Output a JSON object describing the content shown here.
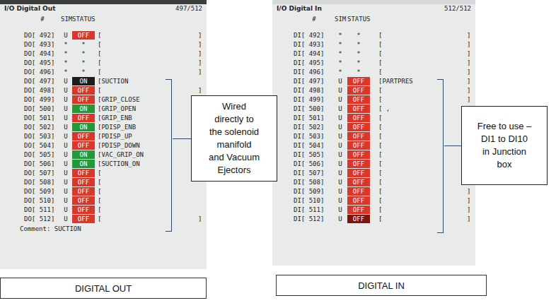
{
  "screens": [
    {
      "title": "I/O Digital Out",
      "page": "497/512",
      "columns": [
        "#",
        "SIM",
        "STATUS"
      ],
      "rows": [
        {
          "id": "DO[ 492]",
          "sim": "U",
          "kind": "signal",
          "status": "OFF",
          "on": false,
          "selected": false,
          "comment": "[",
          "end": "]"
        },
        {
          "id": "DO[ 493]",
          "sim": "*",
          "kind": "unassigned",
          "status": "*",
          "on": false,
          "selected": false,
          "comment": "[",
          "end": "]"
        },
        {
          "id": "DO[ 494]",
          "sim": "*",
          "kind": "unassigned",
          "status": "*",
          "on": false,
          "selected": false,
          "comment": "[",
          "end": "]"
        },
        {
          "id": "DO[ 495]",
          "sim": "*",
          "kind": "unassigned",
          "status": "*",
          "on": false,
          "selected": false,
          "comment": "[",
          "end": "]"
        },
        {
          "id": "DO[ 496]",
          "sim": "*",
          "kind": "unassigned",
          "status": "*",
          "on": false,
          "selected": false,
          "comment": "[",
          "end": "]"
        },
        {
          "id": "DO[ 497]",
          "sim": "U",
          "kind": "signal",
          "status": "ON",
          "on": true,
          "selected": true,
          "comment": "[SUCTION",
          "end": ""
        },
        {
          "id": "DO[ 498]",
          "sim": "U",
          "kind": "signal",
          "status": "OFF",
          "on": false,
          "selected": false,
          "comment": "[",
          "end": "]"
        },
        {
          "id": "DO[ 499]",
          "sim": "U",
          "kind": "signal",
          "status": "OFF",
          "on": false,
          "selected": false,
          "comment": "[GRIP_CLOSE",
          "end": ""
        },
        {
          "id": "DO[ 500]",
          "sim": "U",
          "kind": "signal",
          "status": "ON",
          "on": true,
          "selected": false,
          "comment": "[GRIP_OPEN",
          "end": ""
        },
        {
          "id": "DO[ 501]",
          "sim": "U",
          "kind": "signal",
          "status": "OFF",
          "on": false,
          "selected": false,
          "comment": "[GRIP_ENB",
          "end": ""
        },
        {
          "id": "DO[ 502]",
          "sim": "U",
          "kind": "signal",
          "status": "ON",
          "on": true,
          "selected": false,
          "comment": "[PDISP_ENB",
          "end": ""
        },
        {
          "id": "DO[ 503]",
          "sim": "U",
          "kind": "signal",
          "status": "OFF",
          "on": false,
          "selected": false,
          "comment": "[PDISP_UP",
          "end": ""
        },
        {
          "id": "DO[ 504]",
          "sim": "U",
          "kind": "signal",
          "status": "OFF",
          "on": false,
          "selected": false,
          "comment": "[PDISP_DOWN",
          "end": ""
        },
        {
          "id": "DO[ 505]",
          "sim": "U",
          "kind": "signal",
          "status": "ON",
          "on": true,
          "selected": false,
          "comment": "[VAC_GRIP_ON",
          "end": ""
        },
        {
          "id": "DO[ 506]",
          "sim": "U",
          "kind": "signal",
          "status": "ON",
          "on": true,
          "selected": false,
          "comment": "[SUCTION_ON",
          "end": ""
        },
        {
          "id": "DO[ 507]",
          "sim": "U",
          "kind": "signal",
          "status": "OFF",
          "on": false,
          "selected": false,
          "comment": "[",
          "end": ""
        },
        {
          "id": "DO[ 508]",
          "sim": "U",
          "kind": "signal",
          "status": "OFF",
          "on": false,
          "selected": false,
          "comment": "[",
          "end": ""
        },
        {
          "id": "DO[ 509]",
          "sim": "U",
          "kind": "signal",
          "status": "OFF",
          "on": false,
          "selected": false,
          "comment": "[",
          "end": ""
        },
        {
          "id": "DO[ 510]",
          "sim": "U",
          "kind": "signal",
          "status": "OFF",
          "on": false,
          "selected": false,
          "comment": "[",
          "end": ""
        },
        {
          "id": "DO[ 511]",
          "sim": "U",
          "kind": "signal",
          "status": "OFF",
          "on": false,
          "selected": false,
          "comment": "[",
          "end": ""
        },
        {
          "id": "DO[ 512]",
          "sim": "U",
          "kind": "signal",
          "status": "OFF",
          "on": false,
          "selected": false,
          "comment": "[",
          "end": "]"
        }
      ],
      "comment": "Comment: SUCTION"
    },
    {
      "title": "I/O Digital In",
      "page": "512/512",
      "columns": [
        "#",
        "SIM",
        "STATUS"
      ],
      "rows": [
        {
          "id": "DI[ 492]",
          "sim": "*",
          "kind": "unassigned",
          "status": "*",
          "on": false,
          "selected": false,
          "comment": "[",
          "end": "]"
        },
        {
          "id": "DI[ 493]",
          "sim": "*",
          "kind": "unassigned",
          "status": "*",
          "on": false,
          "selected": false,
          "comment": "[",
          "end": "]"
        },
        {
          "id": "DI[ 494]",
          "sim": "*",
          "kind": "unassigned",
          "status": "*",
          "on": false,
          "selected": false,
          "comment": "[",
          "end": "]"
        },
        {
          "id": "DI[ 495]",
          "sim": "*",
          "kind": "unassigned",
          "status": "*",
          "on": false,
          "selected": false,
          "comment": "[",
          "end": "]"
        },
        {
          "id": "DI[ 496]",
          "sim": "*",
          "kind": "unassigned",
          "status": "*",
          "on": false,
          "selected": false,
          "comment": "[",
          "end": "]"
        },
        {
          "id": "DI[ 497]",
          "sim": "U",
          "kind": "signal",
          "status": "OFF",
          "on": false,
          "selected": false,
          "comment": "[PARTPRES",
          "end": "]"
        },
        {
          "id": "DI[ 498]",
          "sim": "U",
          "kind": "signal",
          "status": "OFF",
          "on": false,
          "selected": false,
          "comment": "[",
          "end": "]"
        },
        {
          "id": "DI[ 499]",
          "sim": "U",
          "kind": "signal",
          "status": "OFF",
          "on": false,
          "selected": false,
          "comment": "[",
          "end": "]"
        },
        {
          "id": "DI[ 500]",
          "sim": "U",
          "kind": "signal",
          "status": "OFF",
          "on": false,
          "selected": false,
          "comment": "[ ,",
          "end": "]"
        },
        {
          "id": "DI[ 501]",
          "sim": "U",
          "kind": "signal",
          "status": "OFF",
          "on": false,
          "selected": false,
          "comment": "[",
          "end": "]"
        },
        {
          "id": "DI[ 502]",
          "sim": "U",
          "kind": "signal",
          "status": "OFF",
          "on": false,
          "selected": false,
          "comment": "[",
          "end": "]"
        },
        {
          "id": "DI[ 503]",
          "sim": "U",
          "kind": "signal",
          "status": "OFF",
          "on": false,
          "selected": false,
          "comment": "[",
          "end": "]"
        },
        {
          "id": "DI[ 504]",
          "sim": "U",
          "kind": "signal",
          "status": "OFF",
          "on": false,
          "selected": false,
          "comment": "[",
          "end": "]"
        },
        {
          "id": "DI[ 505]",
          "sim": "U",
          "kind": "signal",
          "status": "OFF",
          "on": false,
          "selected": false,
          "comment": "[",
          "end": "]"
        },
        {
          "id": "DI[ 506]",
          "sim": "U",
          "kind": "signal",
          "status": "OFF",
          "on": false,
          "selected": false,
          "comment": "[",
          "end": "]"
        },
        {
          "id": "DI[ 507]",
          "sim": "U",
          "kind": "signal",
          "status": "OFF",
          "on": false,
          "selected": false,
          "comment": "[",
          "end": "]"
        },
        {
          "id": "DI[ 508]",
          "sim": "U",
          "kind": "signal",
          "status": "OFF",
          "on": false,
          "selected": false,
          "comment": "[",
          "end": "]"
        },
        {
          "id": "DI[ 509]",
          "sim": "U",
          "kind": "signal",
          "status": "OFF",
          "on": false,
          "selected": false,
          "comment": "[",
          "end": "]"
        },
        {
          "id": "DI[ 510]",
          "sim": "U",
          "kind": "signal",
          "status": "OFF",
          "on": false,
          "selected": false,
          "comment": "[",
          "end": "]"
        },
        {
          "id": "DI[ 511]",
          "sim": "U",
          "kind": "signal",
          "status": "OFF",
          "on": false,
          "selected": false,
          "comment": "[",
          "end": "]"
        },
        {
          "id": "DI[ 512]",
          "sim": "U",
          "kind": "signal",
          "status": "OFF",
          "on": false,
          "selected": true,
          "comment": "[",
          "end": "]"
        }
      ],
      "comment": ""
    }
  ],
  "notes": [
    {
      "lines": [
        "Wired",
        "directly to",
        "the solenoid",
        "manifold",
        "and Vacuum",
        "Ejectors"
      ]
    },
    {
      "lines": [
        "Free to use –",
        "DI1 to DI10",
        "in Junction",
        "box"
      ]
    }
  ],
  "captions": [
    "DIGITAL OUT",
    "DIGITAL IN"
  ]
}
